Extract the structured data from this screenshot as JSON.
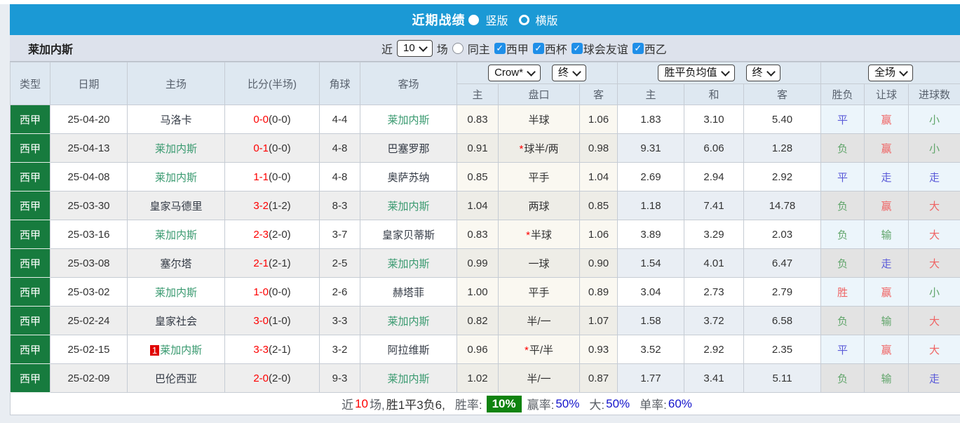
{
  "header": {
    "title": "近期战绩",
    "vertical_label": "竖版",
    "horizontal_label": "横版"
  },
  "filter": {
    "team": "莱加内斯",
    "near_label": "近",
    "matches_selected": "10",
    "games_label": "场",
    "same_home_label": "同主",
    "leagues": [
      {
        "label": "西甲",
        "checked": true
      },
      {
        "label": "西杯",
        "checked": true
      },
      {
        "label": "球会友谊",
        "checked": true
      },
      {
        "label": "西乙",
        "checked": true
      }
    ],
    "check_glyph": "✓"
  },
  "table": {
    "static_headers": [
      "类型",
      "日期",
      "主场",
      "比分(半场)",
      "角球",
      "客场"
    ],
    "odds_group": {
      "select1": "Crow*",
      "select2": "终",
      "cols": [
        "主",
        "盘口",
        "客"
      ]
    },
    "avg_group": {
      "select1": "胜平负均值",
      "select2": "终",
      "cols": [
        "主",
        "和",
        "客"
      ]
    },
    "result_group": {
      "select": "全场",
      "cols": [
        "胜负",
        "让球",
        "进球数"
      ]
    },
    "rows": [
      {
        "type": "西甲",
        "date": "25-04-20",
        "home": "马洛卡",
        "home_focus": false,
        "home_badge": "",
        "score": "0-0",
        "half": "(0-0)",
        "corner": "4-4",
        "away": "莱加内斯",
        "away_focus": true,
        "o_home": "0.83",
        "handicap": "半球",
        "handicap_star": false,
        "o_away": "1.06",
        "avg_home": "1.83",
        "avg_draw": "3.10",
        "avg_away": "5.40",
        "res": [
          {
            "t": "平",
            "c": "blue"
          },
          {
            "t": "赢",
            "c": "red"
          },
          {
            "t": "小",
            "c": "green"
          }
        ]
      },
      {
        "type": "西甲",
        "date": "25-04-13",
        "home": "莱加内斯",
        "home_focus": true,
        "home_badge": "",
        "score": "0-1",
        "half": "(0-0)",
        "corner": "4-8",
        "away": "巴塞罗那",
        "away_focus": false,
        "o_home": "0.91",
        "handicap": "球半/两",
        "handicap_star": true,
        "o_away": "0.98",
        "avg_home": "9.31",
        "avg_draw": "6.06",
        "avg_away": "1.28",
        "res": [
          {
            "t": "负",
            "c": "green"
          },
          {
            "t": "赢",
            "c": "red"
          },
          {
            "t": "小",
            "c": "green"
          }
        ]
      },
      {
        "type": "西甲",
        "date": "25-04-08",
        "home": "莱加内斯",
        "home_focus": true,
        "home_badge": "",
        "score": "1-1",
        "half": "(0-0)",
        "corner": "4-8",
        "away": "奥萨苏纳",
        "away_focus": false,
        "o_home": "0.85",
        "handicap": "平手",
        "handicap_star": false,
        "o_away": "1.04",
        "avg_home": "2.69",
        "avg_draw": "2.94",
        "avg_away": "2.92",
        "res": [
          {
            "t": "平",
            "c": "blue"
          },
          {
            "t": "走",
            "c": "blue"
          },
          {
            "t": "走",
            "c": "blue"
          }
        ]
      },
      {
        "type": "西甲",
        "date": "25-03-30",
        "home": "皇家马德里",
        "home_focus": false,
        "home_badge": "",
        "score": "3-2",
        "half": "(1-2)",
        "corner": "8-3",
        "away": "莱加内斯",
        "away_focus": true,
        "o_home": "1.04",
        "handicap": "两球",
        "handicap_star": false,
        "o_away": "0.85",
        "avg_home": "1.18",
        "avg_draw": "7.41",
        "avg_away": "14.78",
        "res": [
          {
            "t": "负",
            "c": "green"
          },
          {
            "t": "赢",
            "c": "red"
          },
          {
            "t": "大",
            "c": "red"
          }
        ]
      },
      {
        "type": "西甲",
        "date": "25-03-16",
        "home": "莱加内斯",
        "home_focus": true,
        "home_badge": "",
        "score": "2-3",
        "half": "(2-0)",
        "corner": "3-7",
        "away": "皇家贝蒂斯",
        "away_focus": false,
        "o_home": "0.83",
        "handicap": "半球",
        "handicap_star": true,
        "o_away": "1.06",
        "avg_home": "3.89",
        "avg_draw": "3.29",
        "avg_away": "2.03",
        "res": [
          {
            "t": "负",
            "c": "green"
          },
          {
            "t": "输",
            "c": "green"
          },
          {
            "t": "大",
            "c": "red"
          }
        ]
      },
      {
        "type": "西甲",
        "date": "25-03-08",
        "home": "塞尔塔",
        "home_focus": false,
        "home_badge": "",
        "score": "2-1",
        "half": "(2-1)",
        "corner": "2-5",
        "away": "莱加内斯",
        "away_focus": true,
        "o_home": "0.99",
        "handicap": "一球",
        "handicap_star": false,
        "o_away": "0.90",
        "avg_home": "1.54",
        "avg_draw": "4.01",
        "avg_away": "6.47",
        "res": [
          {
            "t": "负",
            "c": "green"
          },
          {
            "t": "走",
            "c": "blue"
          },
          {
            "t": "大",
            "c": "red"
          }
        ]
      },
      {
        "type": "西甲",
        "date": "25-03-02",
        "home": "莱加内斯",
        "home_focus": true,
        "home_badge": "",
        "score": "1-0",
        "half": "(0-0)",
        "corner": "2-6",
        "away": "赫塔菲",
        "away_focus": false,
        "o_home": "1.00",
        "handicap": "平手",
        "handicap_star": false,
        "o_away": "0.89",
        "avg_home": "3.04",
        "avg_draw": "2.73",
        "avg_away": "2.79",
        "res": [
          {
            "t": "胜",
            "c": "red"
          },
          {
            "t": "赢",
            "c": "red"
          },
          {
            "t": "小",
            "c": "green"
          }
        ]
      },
      {
        "type": "西甲",
        "date": "25-02-24",
        "home": "皇家社会",
        "home_focus": false,
        "home_badge": "",
        "score": "3-0",
        "half": "(1-0)",
        "corner": "3-3",
        "away": "莱加内斯",
        "away_focus": true,
        "o_home": "0.82",
        "handicap": "半/一",
        "handicap_star": false,
        "o_away": "1.07",
        "avg_home": "1.58",
        "avg_draw": "3.72",
        "avg_away": "6.58",
        "res": [
          {
            "t": "负",
            "c": "green"
          },
          {
            "t": "输",
            "c": "green"
          },
          {
            "t": "大",
            "c": "red"
          }
        ]
      },
      {
        "type": "西甲",
        "date": "25-02-15",
        "home": "莱加内斯",
        "home_focus": true,
        "home_badge": "1",
        "score": "3-3",
        "half": "(2-1)",
        "corner": "3-2",
        "away": "阿拉维斯",
        "away_focus": false,
        "o_home": "0.96",
        "handicap": "平/半",
        "handicap_star": true,
        "o_away": "0.93",
        "avg_home": "3.52",
        "avg_draw": "2.92",
        "avg_away": "2.35",
        "res": [
          {
            "t": "平",
            "c": "blue"
          },
          {
            "t": "赢",
            "c": "red"
          },
          {
            "t": "大",
            "c": "red"
          }
        ]
      },
      {
        "type": "西甲",
        "date": "25-02-09",
        "home": "巴伦西亚",
        "home_focus": false,
        "home_badge": "",
        "score": "2-0",
        "half": "(2-0)",
        "corner": "9-3",
        "away": "莱加内斯",
        "away_focus": true,
        "o_home": "1.02",
        "handicap": "半/一",
        "handicap_star": false,
        "o_away": "0.87",
        "avg_home": "1.77",
        "avg_draw": "3.41",
        "avg_away": "5.11",
        "res": [
          {
            "t": "负",
            "c": "green"
          },
          {
            "t": "输",
            "c": "green"
          },
          {
            "t": "走",
            "c": "blue"
          }
        ]
      }
    ]
  },
  "summary": {
    "near_label": "近",
    "count": "10",
    "games_label": "场,",
    "record": "胜1平3负6,",
    "rate_label": "胜率:",
    "rate_value": "10%",
    "win_label": "赢率:",
    "win_value": "50%",
    "big_label": "大:",
    "big_value": "50%",
    "single_label": "单率:",
    "single_value": "60%"
  },
  "colors": {
    "accent_blue": "#1b99d5",
    "league_green": "#177b3e",
    "score_red": "#fe0000",
    "focus_team_green": "#3a9a70",
    "result_red": "#ef6363",
    "result_blue": "#5a5ad8",
    "result_green": "#61a56b",
    "rate_badge_green": "#108310",
    "checkbox_blue": "#1f8fe8"
  }
}
